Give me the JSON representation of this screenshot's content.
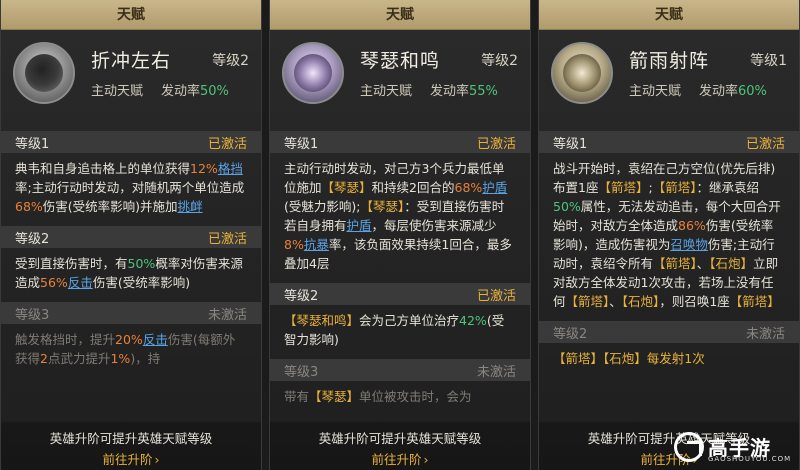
{
  "panels": [
    {
      "title": "天赋",
      "skill_name": "折冲左右",
      "level": "等级2",
      "type": "主动天赋",
      "rate_label": "发动率",
      "rate_value": "50%",
      "levels": [
        {
          "label": "等级1",
          "status": "已激活",
          "segments": [
            {
              "t": "典韦和自身追击格上的单位获得"
            },
            {
              "t": "12%",
              "c": "o"
            },
            {
              "t": "格挡",
              "c": "b",
              "u": true
            },
            {
              "t": "率;"
            },
            {
              "t": "主动行动时发动，对随机两个单位造成"
            },
            {
              "t": "68%",
              "c": "o"
            },
            {
              "t": "伤害(受统率影响)并施加"
            },
            {
              "t": "挑衅",
              "c": "b",
              "u": true
            }
          ]
        },
        {
          "label": "等级2",
          "status": "已激活",
          "segments": [
            {
              "t": "受到直接伤害时，有"
            },
            {
              "t": "50%",
              "c": "g"
            },
            {
              "t": "概率对伤害来源造成"
            },
            {
              "t": "56%",
              "c": "o"
            },
            {
              "t": "反击",
              "c": "b",
              "u": true
            },
            {
              "t": "伤害(受统率影响)"
            }
          ]
        },
        {
          "label": "等级3",
          "status": "未激活",
          "inactive": true,
          "segments": [
            {
              "t": "触发格挡时，提升"
            },
            {
              "t": "20%",
              "c": "o"
            },
            {
              "t": "反击",
              "c": "b",
              "u": true
            },
            {
              "t": "伤害(每额外获得"
            },
            {
              "t": "2",
              "c": "o"
            },
            {
              "t": "点武力提升"
            },
            {
              "t": "1%",
              "c": "o"
            },
            {
              "t": ")，持"
            }
          ]
        }
      ],
      "upgrade_tip": "英雄升阶可提升英雄天赋等级",
      "goto_label": "前往升阶"
    },
    {
      "title": "天赋",
      "skill_name": "琴瑟和鸣",
      "level": "等级2",
      "type": "主动天赋",
      "rate_label": "发动率",
      "rate_value": "55%",
      "levels": [
        {
          "label": "等级1",
          "status": "已激活",
          "segments": [
            {
              "t": "主动行动时发动，对己方3个兵力最低单位施加"
            },
            {
              "t": "【琴瑟】",
              "c": "gold"
            },
            {
              "t": "和持续2回合的"
            },
            {
              "t": "68%",
              "c": "o"
            },
            {
              "t": "护盾",
              "c": "b",
              "u": true
            },
            {
              "t": "(受魅力影响);"
            },
            {
              "t": "【琴瑟】",
              "c": "gold"
            },
            {
              "t": "：受到直接伤害时若自身拥有"
            },
            {
              "t": "护盾",
              "c": "b",
              "u": true
            },
            {
              "t": "，每层使伤害来源减少"
            },
            {
              "t": "8%",
              "c": "o"
            },
            {
              "t": "抗暴",
              "c": "b",
              "u": true
            },
            {
              "t": "率，该负面效果持续1回合，最多叠加4层"
            }
          ]
        },
        {
          "label": "等级2",
          "status": "已激活",
          "segments": [
            {
              "t": "【琴瑟和鸣】",
              "c": "gold"
            },
            {
              "t": "会为己方单位治疗"
            },
            {
              "t": "42%",
              "c": "g"
            },
            {
              "t": "(受智力影响)"
            }
          ]
        },
        {
          "label": "等级3",
          "status": "未激活",
          "inactive": true,
          "segments": [
            {
              "t": "带有"
            },
            {
              "t": "【琴瑟】",
              "c": "gold"
            },
            {
              "t": "单位被攻击时，会为"
            }
          ]
        }
      ],
      "upgrade_tip": "英雄升阶可提升英雄天赋等级",
      "goto_label": "前往升阶"
    },
    {
      "title": "天赋",
      "skill_name": "箭雨射阵",
      "level": "等级1",
      "type": "主动天赋",
      "rate_label": "发动率",
      "rate_value": "60%",
      "levels": [
        {
          "label": "等级1",
          "status": "已激活",
          "segments": [
            {
              "t": "战斗开始时，袁绍在己方空位(优先后排)布置1座"
            },
            {
              "t": "【箭塔】",
              "c": "gold"
            },
            {
              "t": ";"
            },
            {
              "t": "【箭塔】",
              "c": "gold"
            },
            {
              "t": "：继承袁绍"
            },
            {
              "t": "50%",
              "c": "g"
            },
            {
              "t": "属性，无法发动追击，每个大回合开始时，对敌方全体造成"
            },
            {
              "t": "86%",
              "c": "o"
            },
            {
              "t": "伤害(受统率影响)，造成伤害视为"
            },
            {
              "t": "召唤物",
              "c": "b",
              "u": true
            },
            {
              "t": "伤害;"
            },
            {
              "t": "主动行动时，袁绍令所有"
            },
            {
              "t": "【箭塔】",
              "c": "gold"
            },
            {
              "t": "、"
            },
            {
              "t": "【石炮】",
              "c": "gold"
            },
            {
              "t": "立即对敌方全体发动1次攻击，若场上没有任何"
            },
            {
              "t": "【箭塔】",
              "c": "gold"
            },
            {
              "t": "、"
            },
            {
              "t": "【石炮】",
              "c": "gold"
            },
            {
              "t": "，则召唤1座"
            },
            {
              "t": "【箭塔】",
              "c": "gold"
            }
          ]
        },
        {
          "label": "等级2",
          "status": "未激活",
          "inactive": true,
          "segments": [
            {
              "t": "【箭塔】【石炮】每发射1次",
              "c": "gold"
            }
          ]
        }
      ],
      "upgrade_tip": "英雄升阶可提升英雄天赋等级",
      "goto_label": "前往升阶"
    }
  ],
  "watermark": {
    "text": "高手游",
    "sub": "GAOSHOUYOU.COM"
  }
}
